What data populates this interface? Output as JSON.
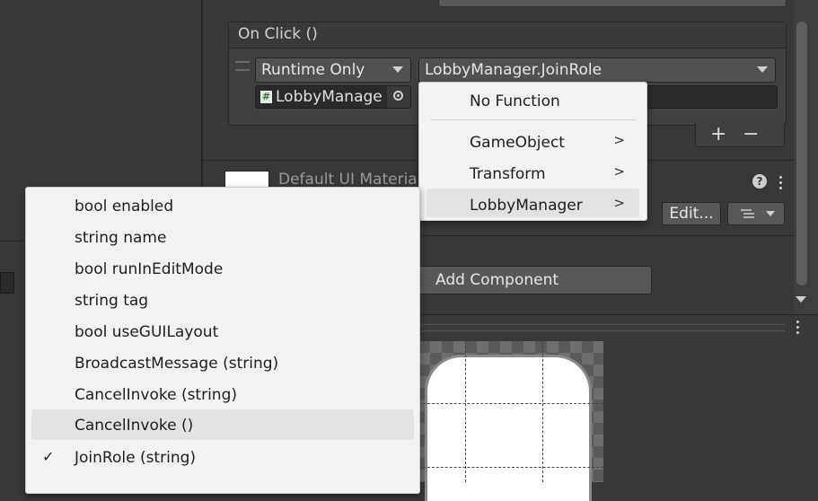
{
  "event": {
    "header": "On Click ()",
    "runtime_dropdown": "Runtime Only",
    "function_dropdown": "LobbyManager.JoinRole",
    "object_field": "LobbyManage",
    "object_icon": "#",
    "add_button": "+",
    "remove_button": "−"
  },
  "material": {
    "name": "Default UI Material",
    "help_icon": "?",
    "edit_button": "Edit..."
  },
  "add_component": "Add Component",
  "context_menu": {
    "items": [
      {
        "label": "No Function",
        "submenu": false
      },
      {
        "label": "GameObject",
        "submenu": true
      },
      {
        "label": "Transform",
        "submenu": true
      },
      {
        "label": "LobbyManager",
        "submenu": true,
        "highlighted": true
      }
    ],
    "arrow": ">"
  },
  "member_list": {
    "items": [
      {
        "label": "bool enabled",
        "checked": false
      },
      {
        "label": "string name",
        "checked": false
      },
      {
        "label": "bool runInEditMode",
        "checked": false
      },
      {
        "label": "string tag",
        "checked": false
      },
      {
        "label": "bool useGUILayout",
        "checked": false
      },
      {
        "label": "BroadcastMessage (string)",
        "checked": false
      },
      {
        "label": "CancelInvoke (string)",
        "checked": false
      },
      {
        "label": "CancelInvoke ()",
        "checked": false,
        "highlighted": true
      },
      {
        "label": "JoinRole (string)",
        "checked": true
      }
    ],
    "check_glyph": "✓"
  },
  "colors": {
    "editor_bg": "#383838",
    "menu_bg": "#f2f2f2",
    "menu_highlight": "#e2e2e2"
  }
}
